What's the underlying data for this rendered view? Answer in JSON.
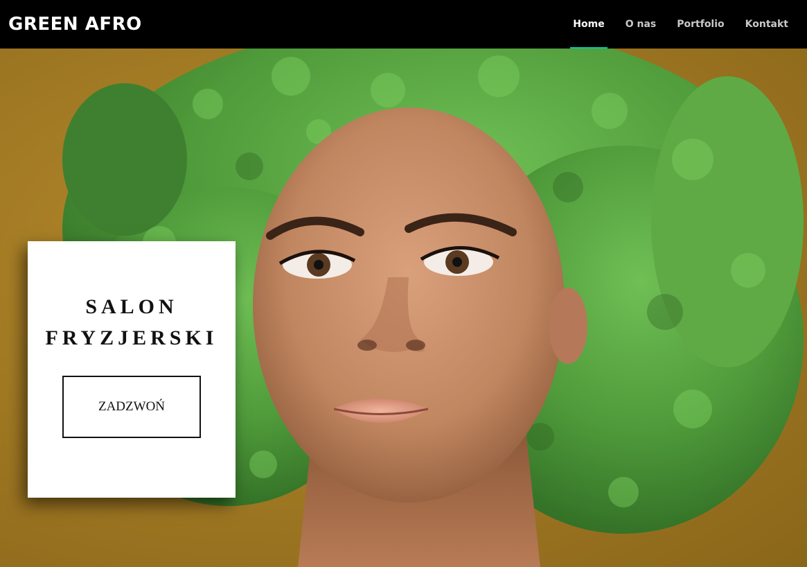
{
  "navbar": {
    "brand": "GREEN AFRO",
    "links": [
      {
        "label": "Home",
        "active": true
      },
      {
        "label": "O nas",
        "active": false
      },
      {
        "label": "Portfolio",
        "active": false
      },
      {
        "label": "Kontakt",
        "active": false
      }
    ],
    "active_indicator_color": "#00c9a7"
  },
  "hero": {
    "title_line1": "SALON",
    "title_line2": "FRYZJERSKI",
    "button_label": "ZADZWOŃ",
    "background_color": "#a27a24",
    "hair_color": "#4f9a3a"
  }
}
